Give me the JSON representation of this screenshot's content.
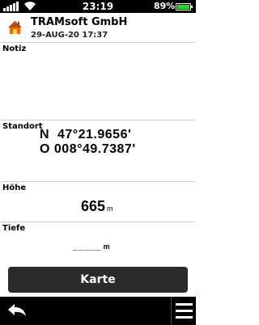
{
  "statusbar": {
    "time": "23:19",
    "battery_percent": "89%",
    "battery_level": 0.89,
    "battery_color": "#22dd22"
  },
  "header": {
    "title": "TRAMsoft GmbH",
    "date": "29-AUG-20 17:37",
    "icon": "home-icon"
  },
  "sections": {
    "notiz": {
      "label": "Notiz"
    },
    "standort": {
      "label": "Standort",
      "line1": "N  47°21.9656'",
      "line2": "O 008°49.7387'"
    },
    "hoehe": {
      "label": "Höhe",
      "value": "665",
      "unit": "m"
    },
    "tiefe": {
      "label": "Tiefe",
      "value": "_____",
      "unit": "m"
    }
  },
  "buttons": {
    "karte": "Karte",
    "back_icon": "back-arrow-icon",
    "menu_icon": "hamburger-menu-icon"
  }
}
